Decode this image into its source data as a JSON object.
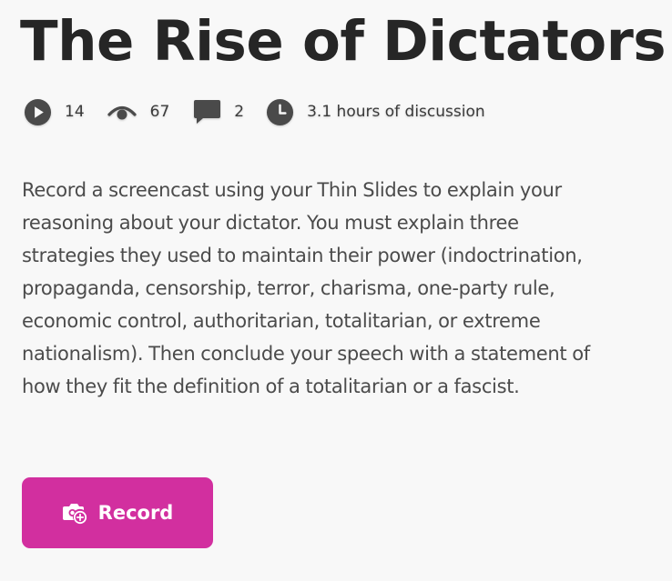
{
  "header": {
    "title": "The Rise of Dictators"
  },
  "stats": {
    "plays": {
      "icon": "play-circle-icon",
      "value": "14"
    },
    "views": {
      "icon": "eye-icon",
      "value": "67"
    },
    "comments": {
      "icon": "comment-icon",
      "value": "2"
    },
    "time": {
      "icon": "clock-icon",
      "value": "3.1 hours of discussion"
    }
  },
  "main": {
    "description": "Record a screencast using your Thin Slides to explain your reasoning about your dictator. You must explain three strategies they used to maintain their power (indoctrination, propaganda, censorship, terror, charisma, one-party rule, economic control, authoritarian, totalitarian, or extreme nationalism). Then conclude your speech with a statement of how they fit the definition of a totalitarian or a fascist."
  },
  "record_button": {
    "label": "Record",
    "icon": "camera-add-icon",
    "color": "#d22f9f"
  },
  "colors": {
    "background": "#f8f8f8",
    "title_text": "#262626",
    "body_text": "#4b4b4b",
    "icon": "#4a4a4a"
  }
}
